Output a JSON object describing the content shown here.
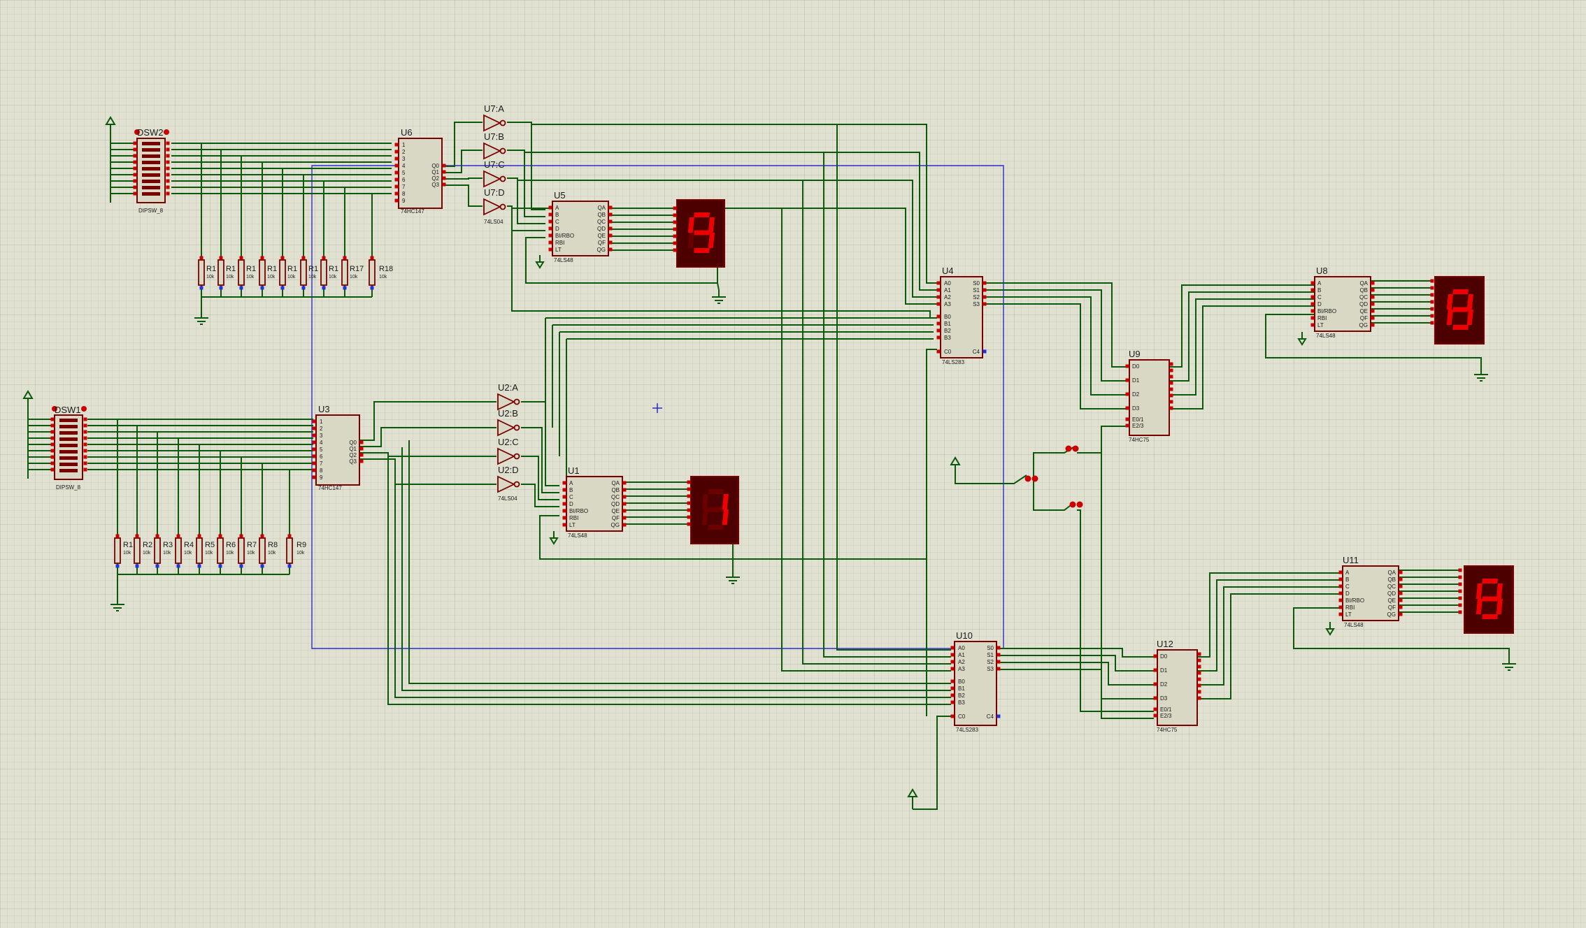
{
  "meta": {
    "title": ""
  },
  "colors": {
    "background": "#e1e1d2",
    "grid": "#c8c8b8",
    "gridMajor": "#b8b8a6",
    "wire": "#0b5a0b",
    "component": "#7a0000",
    "chipFill": "#d8d8c4",
    "bus": "#2b2bd0",
    "segOn": "#ee0000",
    "segOff": "#6a0000",
    "displayBg": "#4d0000",
    "pinRed": "#cc0000",
    "pinBlue": "#2233dd"
  },
  "labels": {
    "dsw2": "DSW2",
    "dsw1": "DSW1",
    "dipsw": "DIPSW_8",
    "u6": "U6",
    "u6t": "74HC147",
    "u3": "U3",
    "u3t": "74HC147",
    "u7a": "U7:A",
    "u7b": "U7:B",
    "u7c": "U7:C",
    "u7d": "U7:D",
    "u2a": "U2:A",
    "u2b": "U2:B",
    "u2c": "U2:C",
    "u2d": "U2:D",
    "ls04": "74LS04",
    "u5": "U5",
    "u1": "U1",
    "u8": "U8",
    "u11": "U11",
    "ls48": "74LS48",
    "u4": "U4",
    "u10": "U10",
    "ls283": "74LS283",
    "u9": "U9",
    "u12": "U12",
    "hc75": "74HC75",
    "r18": "R18",
    "r17": "R17",
    "r1x": "R1",
    "r1": "R1",
    "r2": "R2",
    "r3": "R3",
    "r4": "R4",
    "r5": "R5",
    "r6": "R6",
    "r7": "R7",
    "r8": "R8",
    "r9": "R9",
    "rval": "10k"
  },
  "pins": {
    "ls48L": [
      "A",
      "B",
      "C",
      "D",
      "BI/RBO",
      "RBI",
      "LT"
    ],
    "ls48R": [
      "QA",
      "QB",
      "QC",
      "QD",
      "QE",
      "QF",
      "QG"
    ],
    "hc147": [
      "1",
      "2",
      "3",
      "4",
      "5",
      "6",
      "7",
      "8",
      "9"
    ],
    "hc147out": [
      "Q0",
      "Q1",
      "Q2",
      "Q3"
    ],
    "ls283L": [
      "A0",
      "A1",
      "A2",
      "A3",
      "B0",
      "B1",
      "B2",
      "B3",
      "C0"
    ],
    "ls283R": [
      "S0",
      "S1",
      "S2",
      "S3",
      "C4"
    ],
    "hc75L": [
      "D0",
      "D1",
      "D2",
      "D3",
      "E0/1",
      "E2/3"
    ]
  },
  "displays": {
    "top": "9",
    "middle": "1",
    "right1": "8",
    "right2": "8"
  },
  "icons": [
    "power-arrow-icon",
    "ground-icon",
    "switch-icon",
    "led-icon"
  ]
}
